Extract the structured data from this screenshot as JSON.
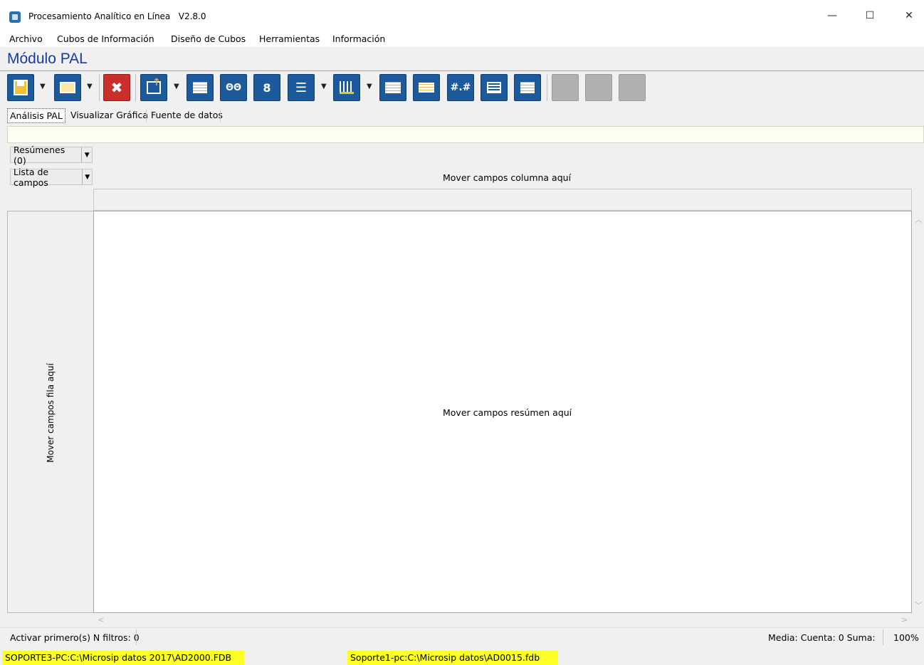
{
  "window": {
    "title": "Procesamiento Analítico en Línea   V2.8.0",
    "controls": {
      "minimize": "—",
      "maximize": "☐",
      "close": "✕"
    }
  },
  "menu": [
    "Archivo",
    "Cubos de Información",
    "Diseño de Cubos",
    "Herramientas",
    "Información"
  ],
  "module_title": "Módulo PAL",
  "toolbar": {
    "buttons": [
      {
        "name": "save-button",
        "icon": "save-icon"
      },
      {
        "name": "open-button",
        "icon": "folder-icon"
      },
      {
        "name": "delete-button",
        "icon": "delete-icon"
      },
      {
        "name": "export-button",
        "icon": "export-icon"
      },
      {
        "name": "grid-button",
        "icon": "grid-icon"
      },
      {
        "name": "columns-button",
        "icon": "columns-icon"
      },
      {
        "name": "rows-button",
        "icon": "rows-icon"
      },
      {
        "name": "list-button",
        "icon": "list-icon"
      },
      {
        "name": "bars-button",
        "icon": "bars-icon"
      },
      {
        "name": "table-button",
        "icon": "table-icon"
      },
      {
        "name": "table-alt-button",
        "icon": "table-alt-icon"
      },
      {
        "name": "number-format-button",
        "icon": "number-format-icon"
      },
      {
        "name": "text-button",
        "icon": "text-icon"
      },
      {
        "name": "info-button",
        "icon": "info-icon"
      }
    ],
    "number_format_glyph": "#.#"
  },
  "tabs": [
    "Análisis PAL",
    "Visualizar Gráfica",
    "Fuente de datos"
  ],
  "pivot": {
    "summaries_label": "Resúmenes (0)",
    "fields_label": "Lista de campos",
    "column_drop": "Mover campos columna aquí",
    "row_drop": "Mover campos fila aquí",
    "data_drop": "Mover campos resúmen aquí"
  },
  "status": {
    "filters": "Activar primero(s) N filtros: 0",
    "aggregates": "Media:  Cuenta: 0  Suma:",
    "zoom": "100%"
  },
  "connections": {
    "left": "SOPORTE3-PC:C:\\Microsip datos 2017\\AD2000.FDB",
    "right": "Soporte1-pc:C:\\Microsip datos\\AD0015.fdb"
  },
  "colors": {
    "module_title": "#1a3aa0",
    "toolbar_blue": "#1d5a9c",
    "highlight": "#ffff28"
  }
}
